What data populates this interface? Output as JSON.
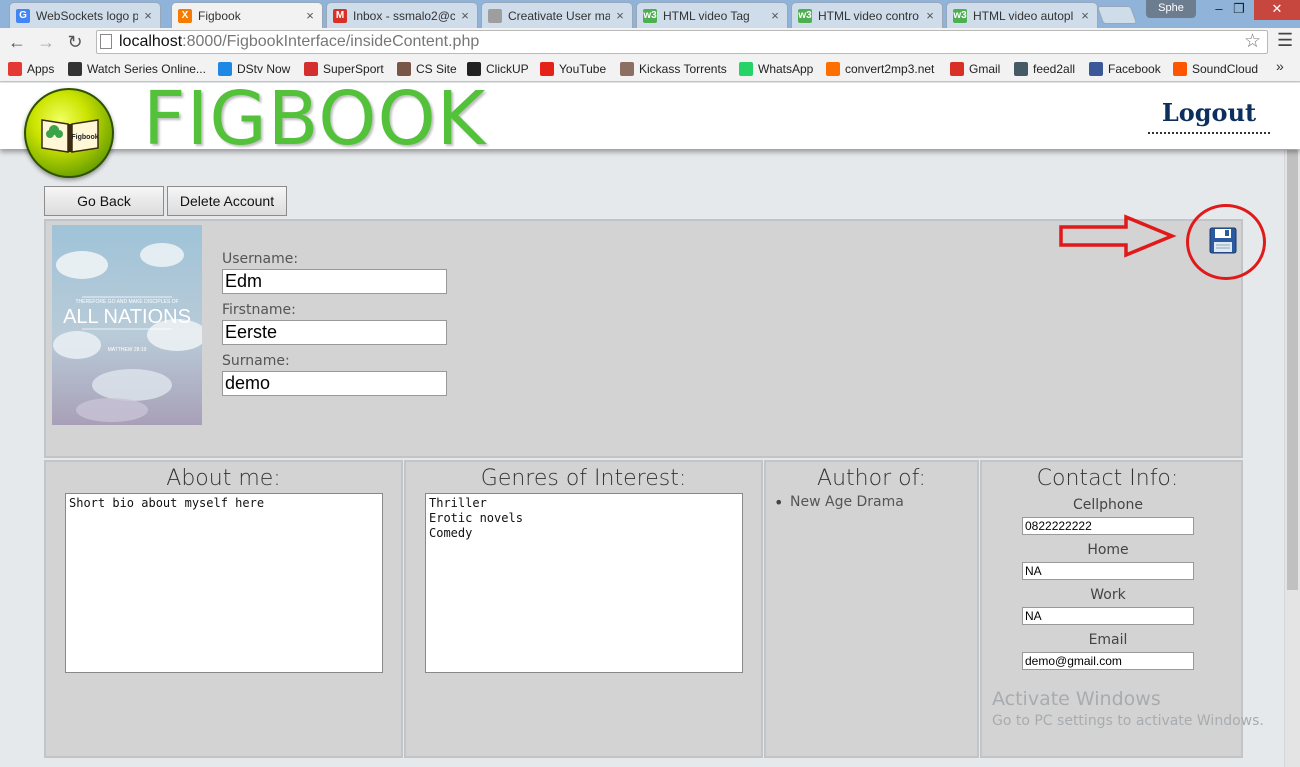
{
  "browser": {
    "tabs": [
      {
        "title": "WebSockets logo p",
        "icon": "google-icon",
        "color": "#4285f4",
        "glyph": "G"
      },
      {
        "title": "Figbook",
        "icon": "xampp-icon",
        "color": "#f57c00",
        "glyph": "X"
      },
      {
        "title": "Inbox - ssmalo2@c",
        "icon": "gmail-icon",
        "color": "#d93025",
        "glyph": "M"
      },
      {
        "title": "Creativate User ma",
        "icon": "page-icon",
        "color": "#9e9e9e",
        "glyph": ""
      },
      {
        "title": "HTML video Tag",
        "icon": "w3schools-icon",
        "color": "#4caf50",
        "glyph": "w3"
      },
      {
        "title": "HTML video contro",
        "icon": "w3schools-icon",
        "color": "#4caf50",
        "glyph": "w3"
      },
      {
        "title": "HTML video autopl",
        "icon": "w3schools-icon",
        "color": "#4caf50",
        "glyph": "w3"
      }
    ],
    "profile_name": "Sphe",
    "url_host": "localhost",
    "url_path": ":8000/FigbookInterface/insideContent.php",
    "bookmarks": [
      {
        "label": "Apps",
        "icon": "apps-icon",
        "color": "#e53935"
      },
      {
        "label": "Watch Series Online...",
        "icon": "bird-icon",
        "color": "#333333"
      },
      {
        "label": "DStv Now",
        "icon": "play-icon",
        "color": "#1e88e5"
      },
      {
        "label": "SuperSport",
        "icon": "supersport-icon",
        "color": "#d32f2f"
      },
      {
        "label": "CS Site",
        "icon": "crest-icon",
        "color": "#795548"
      },
      {
        "label": "ClickUP",
        "icon": "bb-icon",
        "color": "#212121"
      },
      {
        "label": "YouTube",
        "icon": "youtube-icon",
        "color": "#e62117"
      },
      {
        "label": "Kickass Torrents",
        "icon": "kickass-icon",
        "color": "#8d6e63"
      },
      {
        "label": "WhatsApp",
        "icon": "whatsapp-icon",
        "color": "#25d366"
      },
      {
        "label": "convert2mp3.net",
        "icon": "convert-icon",
        "color": "#ff6f00"
      },
      {
        "label": "Gmail",
        "icon": "gmail-icon",
        "color": "#d93025"
      },
      {
        "label": "feed2all",
        "icon": "monitor-icon",
        "color": "#455a64"
      },
      {
        "label": "Facebook",
        "icon": "facebook-icon",
        "color": "#3b5998"
      },
      {
        "label": "SoundCloud",
        "icon": "soundcloud-icon",
        "color": "#ff5500"
      }
    ]
  },
  "header": {
    "brand": "FIGBOOK",
    "logo_text": "Figbook",
    "logout": "Logout"
  },
  "actions": {
    "go_back": "Go Back",
    "delete_account": "Delete Account"
  },
  "profile": {
    "image_title": "ALL NATIONS",
    "image_subtitle": "THEREFORE GO AND MAKE DISCIPLES OF",
    "image_ref": "MATTHEW 28:19",
    "username_label": "Username:",
    "username": "Edm",
    "firstname_label": "Firstname:",
    "firstname": "Eerste",
    "surname_label": "Surname:",
    "surname": "demo"
  },
  "about": {
    "title": "About me:",
    "text": "Short bio about myself here"
  },
  "genres": {
    "title": "Genres of Interest:",
    "text": "Thriller\nErotic novels\nComedy"
  },
  "author": {
    "title": "Author of:",
    "items": [
      "New Age Drama"
    ]
  },
  "contact": {
    "title": "Contact Info:",
    "cellphone_label": "Cellphone",
    "cellphone": "0822222222",
    "home_label": "Home",
    "home": "NA",
    "work_label": "Work",
    "work": "NA",
    "email_label": "Email",
    "email": "demo@gmail.com"
  },
  "watermark": {
    "line1": "Activate Windows",
    "line2": "Go to PC settings to activate Windows."
  },
  "colors": {
    "brand_green": "#54c13a",
    "annotation_red": "#e01a1a",
    "logout_blue": "#0d2f5e"
  }
}
